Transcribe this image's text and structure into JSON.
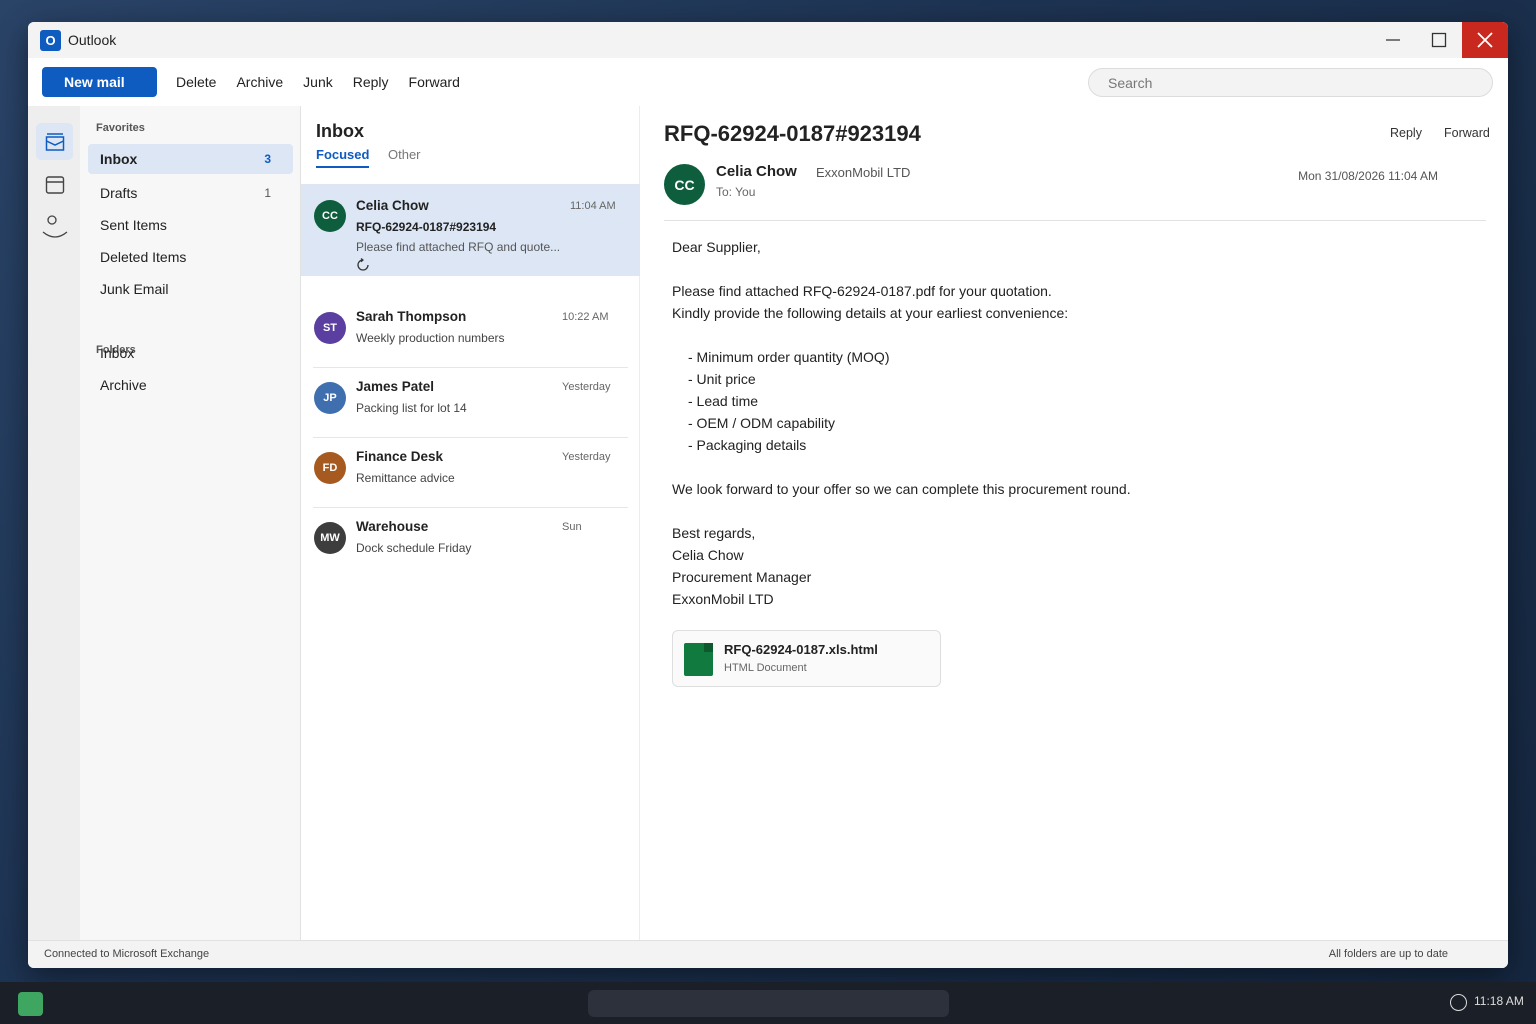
{
  "window": {
    "title": "Outlook",
    "logo_letter": "O"
  },
  "toolbar": {
    "new_mail": "New mail",
    "actions": [
      "Delete",
      "Archive",
      "Junk",
      "Reply",
      "Forward"
    ],
    "search_placeholder": "Search"
  },
  "folders": {
    "favorites_label": "Favorites",
    "favorites": [
      {
        "label": "Inbox",
        "count": "3"
      },
      {
        "label": "Drafts",
        "count": "1"
      },
      {
        "label": "Sent Items",
        "count": ""
      },
      {
        "label": "Deleted Items",
        "count": ""
      },
      {
        "label": "Junk Email",
        "count": ""
      }
    ],
    "folders_label": "Folders",
    "folders": [
      {
        "label": "Inbox"
      },
      {
        "label": "Archive"
      }
    ]
  },
  "message_list": {
    "title": "Inbox",
    "tabs": [
      "Focused",
      "Other"
    ],
    "messages": [
      {
        "initials": "CC",
        "sender": "Celia Chow",
        "time": "11:04 AM",
        "subject": "RFQ-62924-0187#923194",
        "preview": "Please find attached RFQ and quote...",
        "color": "#0e5e3e"
      },
      {
        "initials": "ST",
        "sender": "Sarah Thompson",
        "time": "10:22 AM",
        "subject": "Weekly production numbers",
        "color": "#5a3fa0"
      },
      {
        "initials": "JP",
        "sender": "James Patel",
        "time": "Yesterday",
        "subject": "Packing list for lot 14",
        "color": "#3f6fae"
      },
      {
        "initials": "FD",
        "sender": "Finance Desk",
        "time": "Yesterday",
        "subject": "Remittance advice",
        "color": "#a65a1f"
      },
      {
        "initials": "MW",
        "sender": "Warehouse",
        "time": "Sun",
        "subject": "Dock schedule Friday",
        "color": "#3d3d3d"
      }
    ]
  },
  "reading": {
    "subject": "RFQ-62924-0187#923194",
    "actions": [
      "Reply",
      "Forward"
    ],
    "from_initials": "CC",
    "from_name": "Celia Chow",
    "from_org": "ExxonMobil LTD",
    "to": "To: You",
    "date": "Mon 31/08/2026 11:04 AM",
    "body": [
      "Dear Supplier,",
      "",
      "Please find attached RFQ-62924-0187.pdf for your quotation.",
      "Kindly provide the following details at your earliest convenience:",
      "",
      "- Minimum order quantity (MOQ)",
      "- Unit price",
      "- Lead time",
      "- OEM / ODM capability",
      "- Packaging details",
      "",
      "We look forward to your offer so we can complete this procurement round.",
      "",
      "Best regards,",
      "Celia Chow",
      "Procurement Manager",
      "ExxonMobil LTD"
    ],
    "attachment": {
      "name": "RFQ-62924-0187.xls.html",
      "type": "HTML Document"
    }
  },
  "status": {
    "left": "Connected to Microsoft Exchange",
    "right": "All folders are up to date"
  },
  "taskbar": {
    "time": "11:18 AM"
  }
}
